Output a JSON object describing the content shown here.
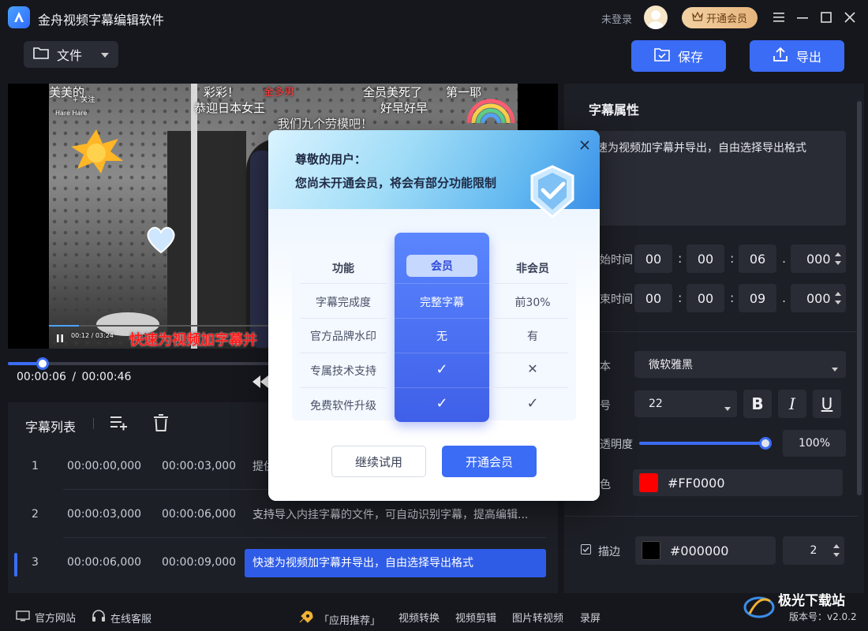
{
  "app": {
    "title": "金舟视频字幕编辑软件",
    "login_status": "未登录",
    "vip_button": "开通会员"
  },
  "toolbar": {
    "file_menu": "文件",
    "save_label": "保存",
    "export_label": "导出"
  },
  "video": {
    "overlay_texts": [
      "美美的",
      "+ 关注",
      "Hare Hare",
      "彩彩！",
      "恭迎日本女王",
      "全员美死了",
      "第一耶",
      "好早好早",
      "我们九个劳模吧！",
      "金多男"
    ],
    "inner_time": "00:12 / 03:24",
    "subtitle_overlay": "快速为视频加字幕并",
    "current_time": "00:00:06",
    "separator": "/",
    "total_time": "00:00:46",
    "progress_fraction": 0.13
  },
  "subtitle_list": {
    "title": "字幕列表",
    "rows": [
      {
        "num": "1",
        "start": "00:00:00,000",
        "end": "00:00:03,000",
        "text": "提供",
        "active": false
      },
      {
        "num": "2",
        "start": "00:00:03,000",
        "end": "00:00:06,000",
        "text": "支持导入内挂字幕的文件，可自动识别字幕，提高编辑...",
        "active": false
      },
      {
        "num": "3",
        "start": "00:00:06,000",
        "end": "00:00:09,000",
        "text": "快速为视频加字幕并导出，自由选择导出格式",
        "active": true
      }
    ]
  },
  "properties": {
    "title": "字幕属性",
    "text_value": "速为视频加字幕并导出，自由选择导出格式",
    "start_label": "始时间",
    "end_label": "束时间",
    "start_time": {
      "h": "00",
      "m": "00",
      "s": "06",
      "ms": "000"
    },
    "end_time": {
      "h": "00",
      "m": "00",
      "s": "09",
      "ms": "000"
    },
    "font_label": "本",
    "font_value": "微软雅黑",
    "size_label": "号",
    "size_value": "22",
    "opacity_label": "透明度",
    "opacity_value": "100%",
    "opacity_fraction": 1.0,
    "color_label": "色",
    "color_value": "#FF0000",
    "stroke_label": "描边",
    "stroke_color": "#000000",
    "stroke_width": "2",
    "bold_label": "B",
    "italic_label": "I",
    "underline_label": "U"
  },
  "modal": {
    "greeting": "尊敬的用户：",
    "subtitle": "您尚未开通会员，将会有部分功能限制",
    "columns": [
      "功能",
      "会员",
      "非会员"
    ],
    "rows": [
      {
        "feature": "字幕完成度",
        "vip": "完整字幕",
        "free": "前30%"
      },
      {
        "feature": "官方品牌水印",
        "vip": "无",
        "free": "有"
      },
      {
        "feature": "专属技术支持",
        "vip": "✓",
        "free": "✕"
      },
      {
        "feature": "免费软件升级",
        "vip": "✓",
        "free": "✓"
      }
    ],
    "trial_button": "继续试用",
    "open_vip_button": "开通会员"
  },
  "status_bar": {
    "website": "官方网站",
    "support": "在线客服",
    "app_recommend": "「应用推荐」",
    "video_convert": "视频转换",
    "video_edit": "视频剪辑",
    "image_to_video": "图片转视频",
    "screen_record": "录屏",
    "version": "版本号：v2.0.2"
  },
  "colors": {
    "accent": "#3b6cf5",
    "background": "#16171d",
    "panel": "#1d1f26",
    "subtitle_red": "#FF0000"
  }
}
